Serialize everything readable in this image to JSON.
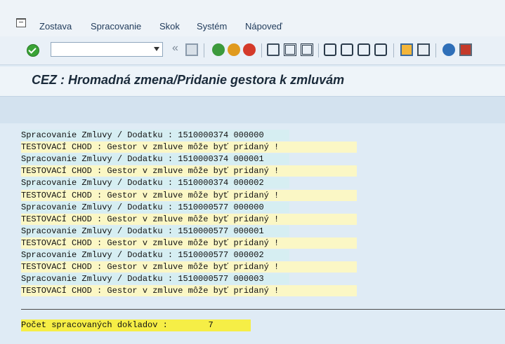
{
  "menubar": {
    "items": [
      "Zostava",
      "Spracovanie",
      "Skok",
      "Systém",
      "Nápoveď"
    ]
  },
  "toolbar": {
    "command_value": "",
    "icons": [
      "enter-icon",
      "command-field",
      "back-nav-icon",
      "save-icon",
      "back-icon",
      "exit-icon",
      "cancel-icon",
      "print-icon",
      "find-icon",
      "find-next-icon",
      "first-page-icon",
      "prev-page-icon",
      "next-page-icon",
      "last-page-icon",
      "new-session-icon",
      "shortcut-icon",
      "help-icon",
      "customize-icon"
    ]
  },
  "title": "CEZ : Hromadná zmena/Pridanie gestora k zmluvám",
  "lines": [
    {
      "kind": "proc",
      "text": "Spracovanie Zmluvy / Dodatku : 1510000374 000000"
    },
    {
      "kind": "test",
      "text": "TESTOVACÍ CHOD : Gestor v zmluve môže byť pridaný !"
    },
    {
      "kind": "proc",
      "text": "Spracovanie Zmluvy / Dodatku : 1510000374 000001"
    },
    {
      "kind": "test",
      "text": "TESTOVACÍ CHOD : Gestor v zmluve môže byť pridaný !"
    },
    {
      "kind": "proc",
      "text": "Spracovanie Zmluvy / Dodatku : 1510000374 000002"
    },
    {
      "kind": "test",
      "text": "TESTOVACÍ CHOD : Gestor v zmluve môže byť pridaný !"
    },
    {
      "kind": "proc",
      "text": "Spracovanie Zmluvy / Dodatku : 1510000577 000000"
    },
    {
      "kind": "test",
      "text": "TESTOVACÍ CHOD : Gestor v zmluve môže byť pridaný !"
    },
    {
      "kind": "proc",
      "text": "Spracovanie Zmluvy / Dodatku : 1510000577 000001"
    },
    {
      "kind": "test",
      "text": "TESTOVACÍ CHOD : Gestor v zmluve môže byť pridaný !"
    },
    {
      "kind": "proc",
      "text": "Spracovanie Zmluvy / Dodatku : 1510000577 000002"
    },
    {
      "kind": "test",
      "text": "TESTOVACÍ CHOD : Gestor v zmluve môže byť pridaný !"
    },
    {
      "kind": "proc",
      "text": "Spracovanie Zmluvy / Dodatku : 1510000577 000003"
    },
    {
      "kind": "test",
      "text": "TESTOVACÍ CHOD : Gestor v zmluve môže byť pridaný !"
    }
  ],
  "summary": "Počet spracovaných dokladov :        7",
  "colors": {
    "proc_bg": "#d6eef2",
    "test_bg": "#fbf7c5",
    "summary_bg": "#f6ee46",
    "screen_bg": "#dfebf5"
  }
}
